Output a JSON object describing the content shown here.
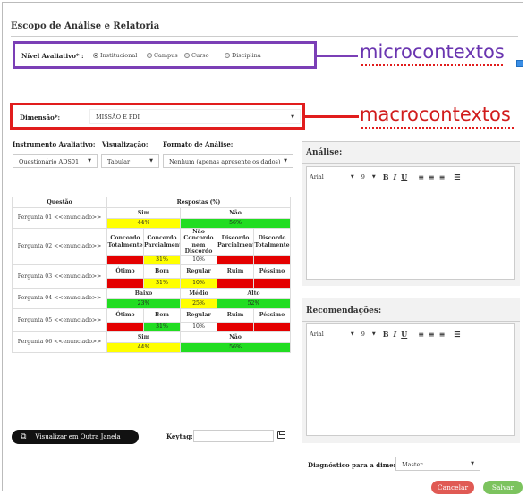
{
  "header": {
    "title": "Escopo de Análise e Relatoria"
  },
  "nivel": {
    "label": "Nível Avaliativo* :",
    "options": [
      "Institucional",
      "Campus",
      "Curso",
      "Disciplina"
    ],
    "selected": "Institucional"
  },
  "annotations": {
    "micro": "microcontextos",
    "macro": "macrocontextos"
  },
  "dimensao": {
    "label": "Dimensão*:",
    "value": "MISSÃO E PDI"
  },
  "instrumento": {
    "label": "Instrumento Avaliativo:",
    "value": "Questionário ADS01"
  },
  "visualizacao": {
    "label": "Visualização:",
    "value": "Tabular"
  },
  "formato": {
    "label": "Formato de Análise:",
    "value": "Nenhum (apenas apresente os dados)"
  },
  "table": {
    "col_question": "Questão",
    "col_responses": "Respostas (%)",
    "rows": [
      {
        "question": "Pergunta 01 <<enunciado>>",
        "headers": [
          "Sim",
          "Não"
        ],
        "values": [
          "44%",
          "56%"
        ]
      },
      {
        "question": "Pergunta 02 <<enunciado>>",
        "headers": [
          "Concordo Totalmente",
          "Concordo Parcialmente",
          "Não Concordo nem Discordo",
          "Discordo Parcialmente",
          "Discordo Totalmente"
        ],
        "values": [
          "",
          "31%",
          "10%",
          "",
          ""
        ]
      },
      {
        "question": "Pergunta 03 <<enunciado>>",
        "headers": [
          "Ótimo",
          "Bom",
          "Regular",
          "Ruim",
          "Péssimo"
        ],
        "values": [
          "",
          "31%",
          "10%",
          "",
          ""
        ]
      },
      {
        "question": "Pergunta 04 <<enunciado>>",
        "headers": [
          "Baixo",
          "Médio",
          "Alto"
        ],
        "values": [
          "23%",
          "25%",
          "52%"
        ]
      },
      {
        "question": "Pergunta 05 <<enunciado>>",
        "headers": [
          "Ótimo",
          "Bom",
          "Regular",
          "Ruim",
          "Péssimo"
        ],
        "values": [
          "",
          "31%",
          "10%",
          "",
          ""
        ]
      },
      {
        "question": "Pergunta 06 <<enunciado>>",
        "headers": [
          "Sim",
          "Não"
        ],
        "values": [
          "44%",
          "56%"
        ]
      }
    ]
  },
  "analise": {
    "title": "Análise:",
    "font": "Arial",
    "size": "9",
    "tools": [
      "B",
      "I",
      "U"
    ]
  },
  "recomendacoes": {
    "title": "Recomendações:",
    "font": "Arial",
    "size": "9",
    "tools": [
      "B",
      "I",
      "U"
    ]
  },
  "actions": {
    "open_window": "Visualizar em Outra Janela",
    "keytag_label": "Keytag:",
    "diagnostico_label": "Diagnóstico para a dimensão:",
    "diagnostico_value": "Master",
    "cancel": "Cancelar",
    "save": "Salvar"
  },
  "colors": {
    "purple": "#7b3fb6",
    "red": "#e11d1d",
    "yellow": "#ffff00",
    "green": "#22dd22",
    "dark_red": "#e40000",
    "cancel": "#e05a54",
    "save": "#7cc35e"
  }
}
